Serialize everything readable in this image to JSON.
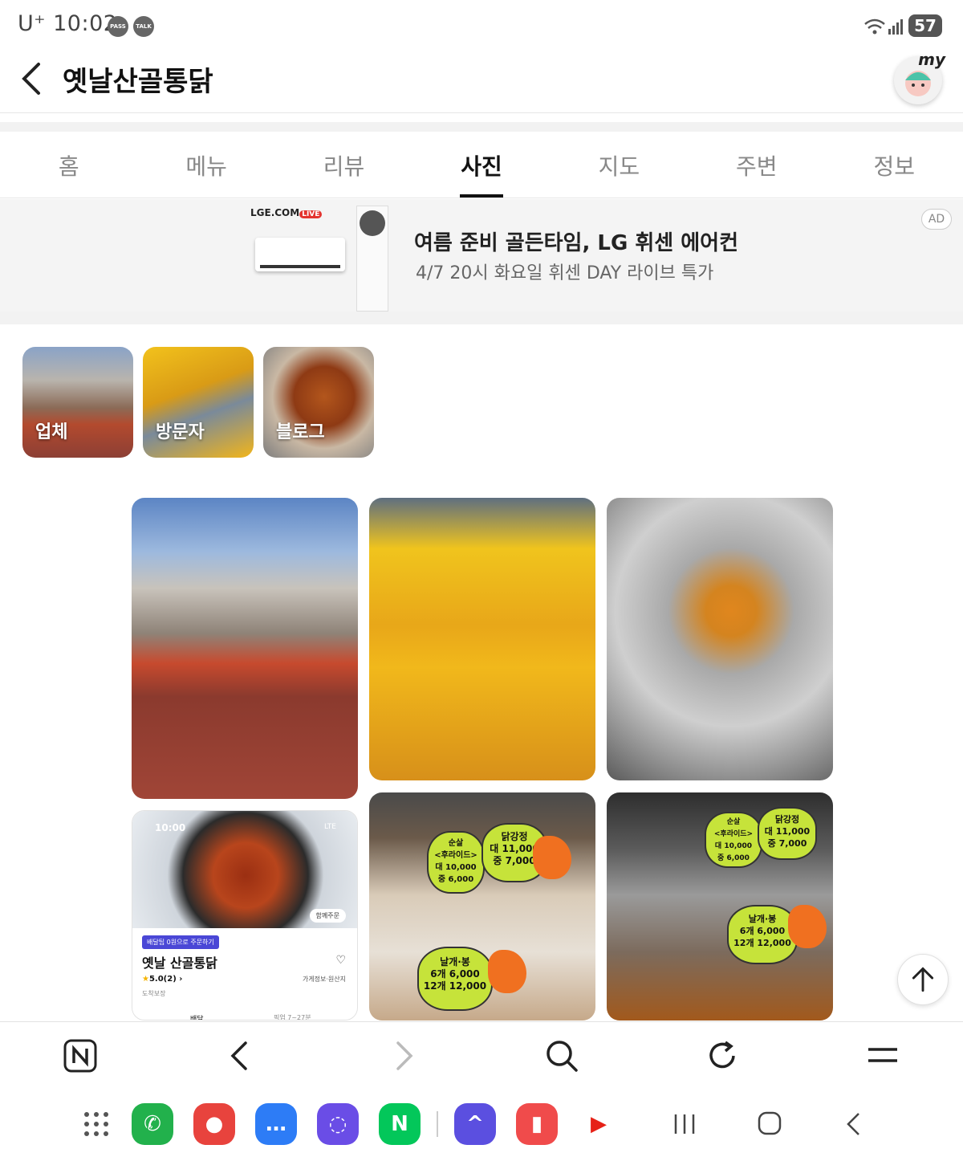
{
  "status_bar": {
    "carrier": "U⁺",
    "time": "10:02",
    "pass_badge": "PASS",
    "talk_badge": "TALK",
    "battery": "57"
  },
  "header": {
    "title": "옛날산골통닭",
    "my_label": "my",
    "back_icon": "chevron-left-icon"
  },
  "tabs": [
    {
      "label": "홈",
      "active": false
    },
    {
      "label": "메뉴",
      "active": false
    },
    {
      "label": "리뷰",
      "active": false
    },
    {
      "label": "사진",
      "active": true
    },
    {
      "label": "지도",
      "active": false
    },
    {
      "label": "주변",
      "active": false
    },
    {
      "label": "정보",
      "active": false
    }
  ],
  "ad": {
    "brand": "LGE.COM",
    "live": "LIVE",
    "headline": "여름 준비 골든타임, LG 휘센 에어컨",
    "subline": "4/7 20시 화요일 휘센 DAY 라이브 특가",
    "badge": "AD"
  },
  "categories": [
    {
      "label": "업체"
    },
    {
      "label": "방문자"
    },
    {
      "label": "블로그"
    }
  ],
  "photo_screenshot": {
    "time": "10:00",
    "signal": "LTE",
    "group_order": "함께주문",
    "promo": "배달팁 0원으로 주문하기",
    "name": "옛날 산골통닭",
    "rating": "5.0(2)",
    "info": "가게정보·원산지",
    "addr": "도착보장",
    "tab_delivery": "배달",
    "tab_pickup": "픽업 7~27분"
  },
  "signs": {
    "boneless": "순살\n<후라이드>\n대 10,000\n중 6,000",
    "gangjeong": "닭강정\n대 11,000\n중 7,000",
    "wings": "날개·봉\n6개 6,000\n12개 12,000"
  },
  "browser_bar": {
    "icons": [
      "naver-home-icon",
      "back-icon",
      "forward-icon",
      "search-icon",
      "refresh-icon",
      "menu-icon"
    ]
  },
  "dock": {
    "apps": [
      {
        "name": "phone",
        "color": "#22b14c",
        "glyph": "✆"
      },
      {
        "name": "contacts",
        "color": "#e8433d",
        "glyph": "●"
      },
      {
        "name": "messages",
        "color": "#2d7cf6",
        "glyph": "…"
      },
      {
        "name": "internet",
        "color": "#6a4de6",
        "glyph": "◌"
      },
      {
        "name": "naver",
        "color": "#03c75a",
        "glyph": "N"
      },
      {
        "name": "app-a",
        "color": "#5b4fe0",
        "glyph": "^"
      },
      {
        "name": "notes",
        "color": "#f04b4b",
        "glyph": "▮"
      },
      {
        "name": "youtube",
        "color": "#ffffff",
        "glyph": "▶"
      }
    ]
  },
  "colors": {
    "active_tab": "#111111",
    "inactive_tab": "#888888",
    "ad_bg": "#f4f4f4"
  }
}
